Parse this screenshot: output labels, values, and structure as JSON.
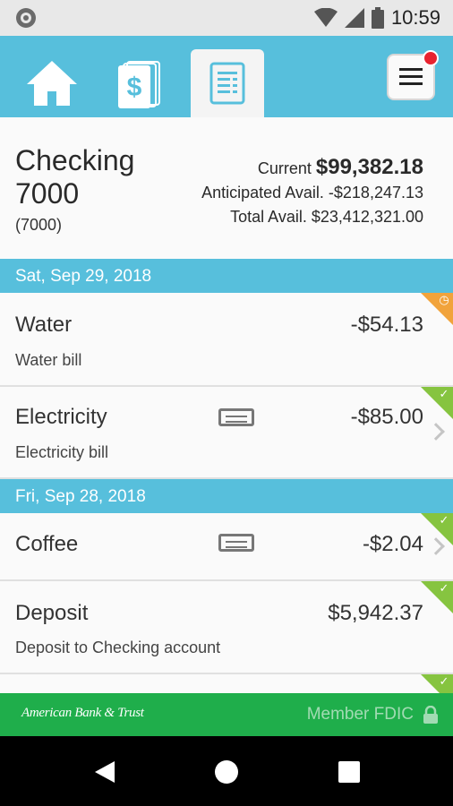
{
  "status_bar": {
    "time": "10:59"
  },
  "nav": {
    "tabs": [
      "home",
      "payments",
      "accounts"
    ],
    "active_tab": "accounts"
  },
  "account": {
    "name": "Checking 7000",
    "sub": "(7000)",
    "current_label": "Current",
    "current_value": "$99,382.18",
    "anticipated_label": "Anticipated Avail.",
    "anticipated_value": "-$218,247.13",
    "total_label": "Total Avail.",
    "total_value": "$23,412,321.00"
  },
  "groups": [
    {
      "date": "Sat, Sep 29, 2018",
      "transactions": [
        {
          "name": "Water",
          "description": "Water bill",
          "amount": "-$54.13",
          "status": "pending",
          "receipt": false,
          "chevron": false
        },
        {
          "name": "Electricity",
          "description": "Electricity bill",
          "amount": "-$85.00",
          "status": "cleared",
          "receipt": true,
          "chevron": true
        }
      ]
    },
    {
      "date": "Fri, Sep 28, 2018",
      "transactions": [
        {
          "name": "Coffee",
          "description": "",
          "amount": "-$2.04",
          "status": "cleared",
          "receipt": true,
          "chevron": true
        },
        {
          "name": "Deposit",
          "description": "Deposit to Checking account",
          "amount": "$5,942.37",
          "status": "cleared",
          "receipt": false,
          "chevron": false
        }
      ]
    }
  ],
  "footer": {
    "bank_name": "American Bank & Trust",
    "fdic": "Member FDIC"
  },
  "colors": {
    "accent": "#57bfdc",
    "cleared": "#86c440",
    "pending": "#f1a33b",
    "footer": "#1fae4b"
  }
}
